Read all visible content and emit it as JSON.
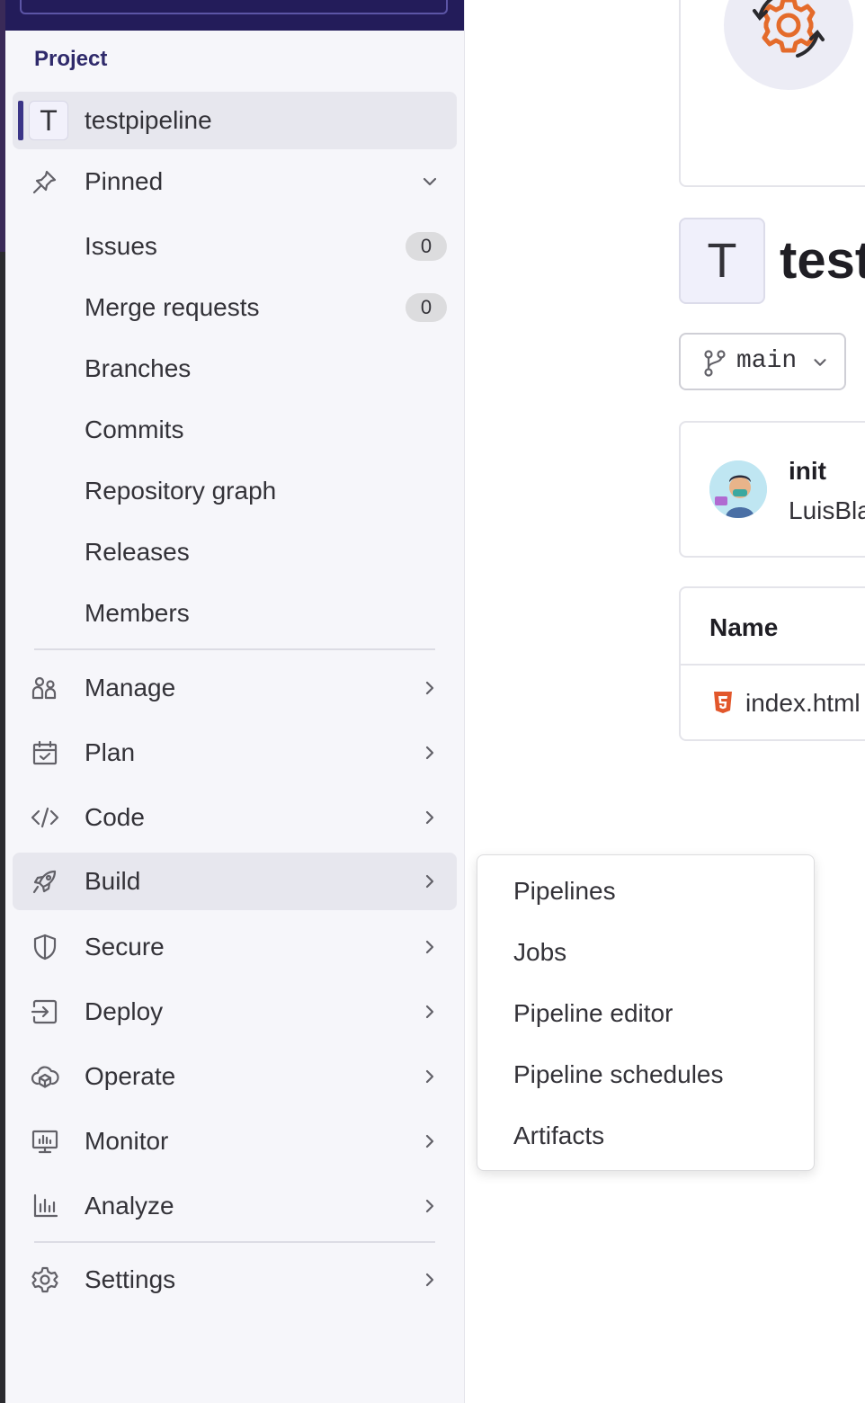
{
  "sidebar": {
    "section_title": "Project",
    "project": {
      "initial": "T",
      "name": "testpipeline"
    },
    "pinned": {
      "label": "Pinned",
      "items": [
        {
          "label": "Issues",
          "count": "0"
        },
        {
          "label": "Merge requests",
          "count": "0"
        },
        {
          "label": "Branches"
        },
        {
          "label": "Commits"
        },
        {
          "label": "Repository graph"
        },
        {
          "label": "Releases"
        },
        {
          "label": "Members"
        }
      ]
    },
    "nav": [
      {
        "label": "Manage",
        "icon": "users-icon"
      },
      {
        "label": "Plan",
        "icon": "calendar-icon"
      },
      {
        "label": "Code",
        "icon": "code-icon"
      },
      {
        "label": "Build",
        "icon": "rocket-icon"
      },
      {
        "label": "Secure",
        "icon": "shield-icon"
      },
      {
        "label": "Deploy",
        "icon": "deploy-icon"
      },
      {
        "label": "Operate",
        "icon": "cloud-icon"
      },
      {
        "label": "Monitor",
        "icon": "monitor-icon"
      },
      {
        "label": "Analyze",
        "icon": "chart-icon"
      }
    ],
    "settings": {
      "label": "Settings",
      "icon": "gear-icon"
    }
  },
  "build_menu": {
    "items": [
      "Pipelines",
      "Jobs",
      "Pipeline editor",
      "Pipeline schedules",
      "Artifacts"
    ]
  },
  "main": {
    "project_initial": "T",
    "project_title": "test",
    "branch": "main",
    "commit": {
      "title": "init",
      "author": "LuisBla"
    },
    "files": {
      "column_name": "Name",
      "rows": [
        "index.html"
      ]
    }
  },
  "colors": {
    "sidebar_bg": "#f6f6fa",
    "accent": "#3b3587",
    "topbar": "#231c5a",
    "html_icon": "#e2572b"
  }
}
